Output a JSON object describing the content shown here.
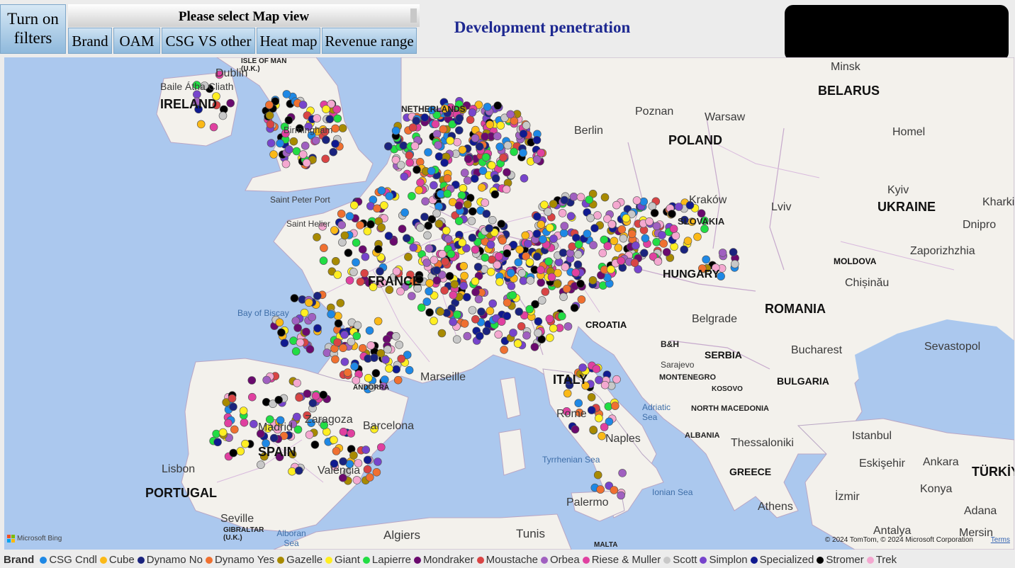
{
  "filters_button": "Turn on filters",
  "map_view": {
    "header": "Please select Map view",
    "tabs": [
      "Brand",
      "OAM",
      "CSG VS other",
      "Heat map",
      "Revenue range"
    ]
  },
  "page_title": "Development penetration",
  "map": {
    "countries": [
      "IRELAND",
      "BELARUS",
      "POLAND",
      "UKRAINE",
      "FRANCE",
      "HUNGARY",
      "ROMANIA",
      "PORTUGAL",
      "SPAIN",
      "ITALY",
      "CROATIA",
      "SERBIA",
      "BULGARIA",
      "GREECE",
      "MOLDOVA",
      "TÜRKİY"
    ],
    "cities": [
      "Dublin",
      "Baile Átha Cliath",
      "Birmingham",
      "Minsk",
      "Poznan",
      "Warsaw",
      "Homel",
      "Kraków",
      "Kyiv",
      "Lviv",
      "Kharkiv",
      "Dnipro",
      "Zaporizhzhia",
      "Chișinău",
      "Saint Peter Port",
      "Saint Helier",
      "Belgrade",
      "Bucharest",
      "Sevastopol",
      "Sarajevo",
      "Madrid",
      "Zaragoza",
      "Barcelona",
      "Valencia",
      "Lisbon",
      "Seville",
      "Marseille",
      "Rome",
      "Naples",
      "Palermo",
      "Algiers",
      "Tunis",
      "Istanbul",
      "Eskişehir",
      "Ankara",
      "Konya",
      "İzmir",
      "Athens",
      "Thessaloniki",
      "Adana",
      "Antalya",
      "Mersin",
      "Berlin"
    ],
    "small_labels": [
      "ISLE OF MAN (U.K.)",
      "NETHERLANDS",
      "B&H",
      "MONTENEGRO",
      "KOSOVO",
      "NORTH MACEDONIA",
      "ALBANIA",
      "SLOVAKIA",
      "GIBRALTAR (U.K.)",
      "ANDORRA",
      "MALTA"
    ],
    "seas": [
      "Bay of Biscay",
      "Adriatic Sea",
      "Tyrrhenian Sea",
      "Ionian Sea",
      "Alboran Sea"
    ],
    "attribution": "© 2024 TomTom, © 2024 Microsoft Corporation",
    "terms": "Terms",
    "provider": "Microsoft Bing"
  },
  "legend": {
    "title": "Brand",
    "items": [
      {
        "name": "CSG Cndl",
        "color": "#1e88e5"
      },
      {
        "name": "Cube",
        "color": "#fbb917"
      },
      {
        "name": "Dynamo No",
        "color": "#1a237e"
      },
      {
        "name": "Dynamo Yes",
        "color": "#f07030"
      },
      {
        "name": "Gazelle",
        "color": "#a88a00"
      },
      {
        "name": "Giant",
        "color": "#ffee22"
      },
      {
        "name": "Lapierre",
        "color": "#22dd44"
      },
      {
        "name": "Mondraker",
        "color": "#6a0a6e"
      },
      {
        "name": "Moustache",
        "color": "#d94444"
      },
      {
        "name": "Orbea",
        "color": "#a060c0"
      },
      {
        "name": "Riese & Muller",
        "color": "#e040a0"
      },
      {
        "name": "Scott",
        "color": "#c8c8c8"
      },
      {
        "name": "Simplon",
        "color": "#7744cc"
      },
      {
        "name": "Specialized",
        "color": "#101a90"
      },
      {
        "name": "Stromer",
        "color": "#000000"
      },
      {
        "name": "Trek",
        "color": "#f4a8d0"
      }
    ]
  }
}
